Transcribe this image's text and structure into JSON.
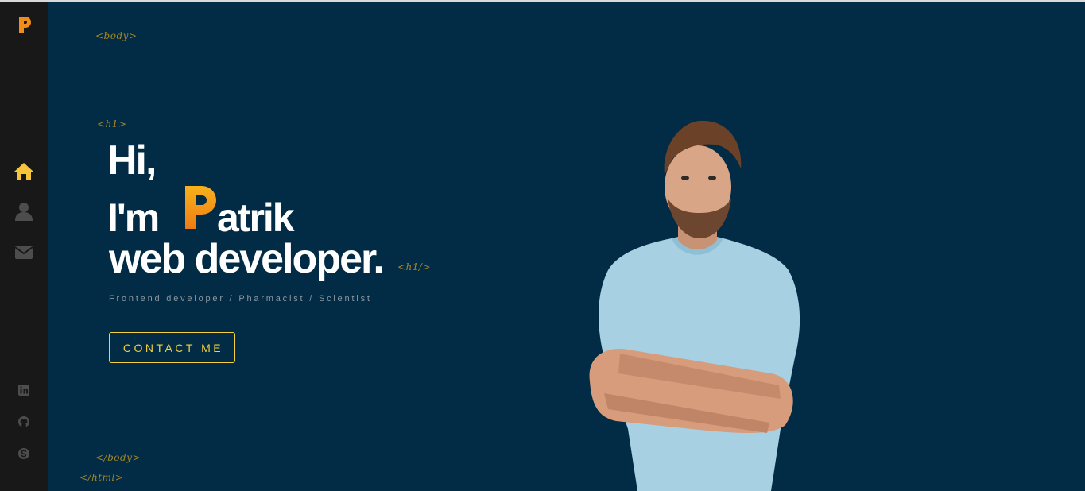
{
  "tags": {
    "body_open": "<body>",
    "h1_open": "<h1>",
    "h1_close": "<h1/>",
    "body_close": "</body>",
    "html_close": "</html>"
  },
  "hero": {
    "greeting": "Hi,",
    "im": "I'm",
    "name_rest": "atrik",
    "role": "web developer.",
    "subtitle": "Frontend developer / Pharmacist / Scientist",
    "contact_label": "CONTACT ME"
  },
  "sidebar": {
    "logo": "p-logo-icon",
    "nav": [
      {
        "icon": "home-icon",
        "active": true
      },
      {
        "icon": "user-icon",
        "active": false
      },
      {
        "icon": "envelope-icon",
        "active": false
      }
    ],
    "social": [
      "linkedin-icon",
      "github-icon",
      "skype-icon"
    ]
  },
  "colors": {
    "background": "#022b45",
    "sidebar": "#181818",
    "accent": "#f5d03b",
    "tag": "#a3862a",
    "logo_orange": "#f28c1a"
  }
}
